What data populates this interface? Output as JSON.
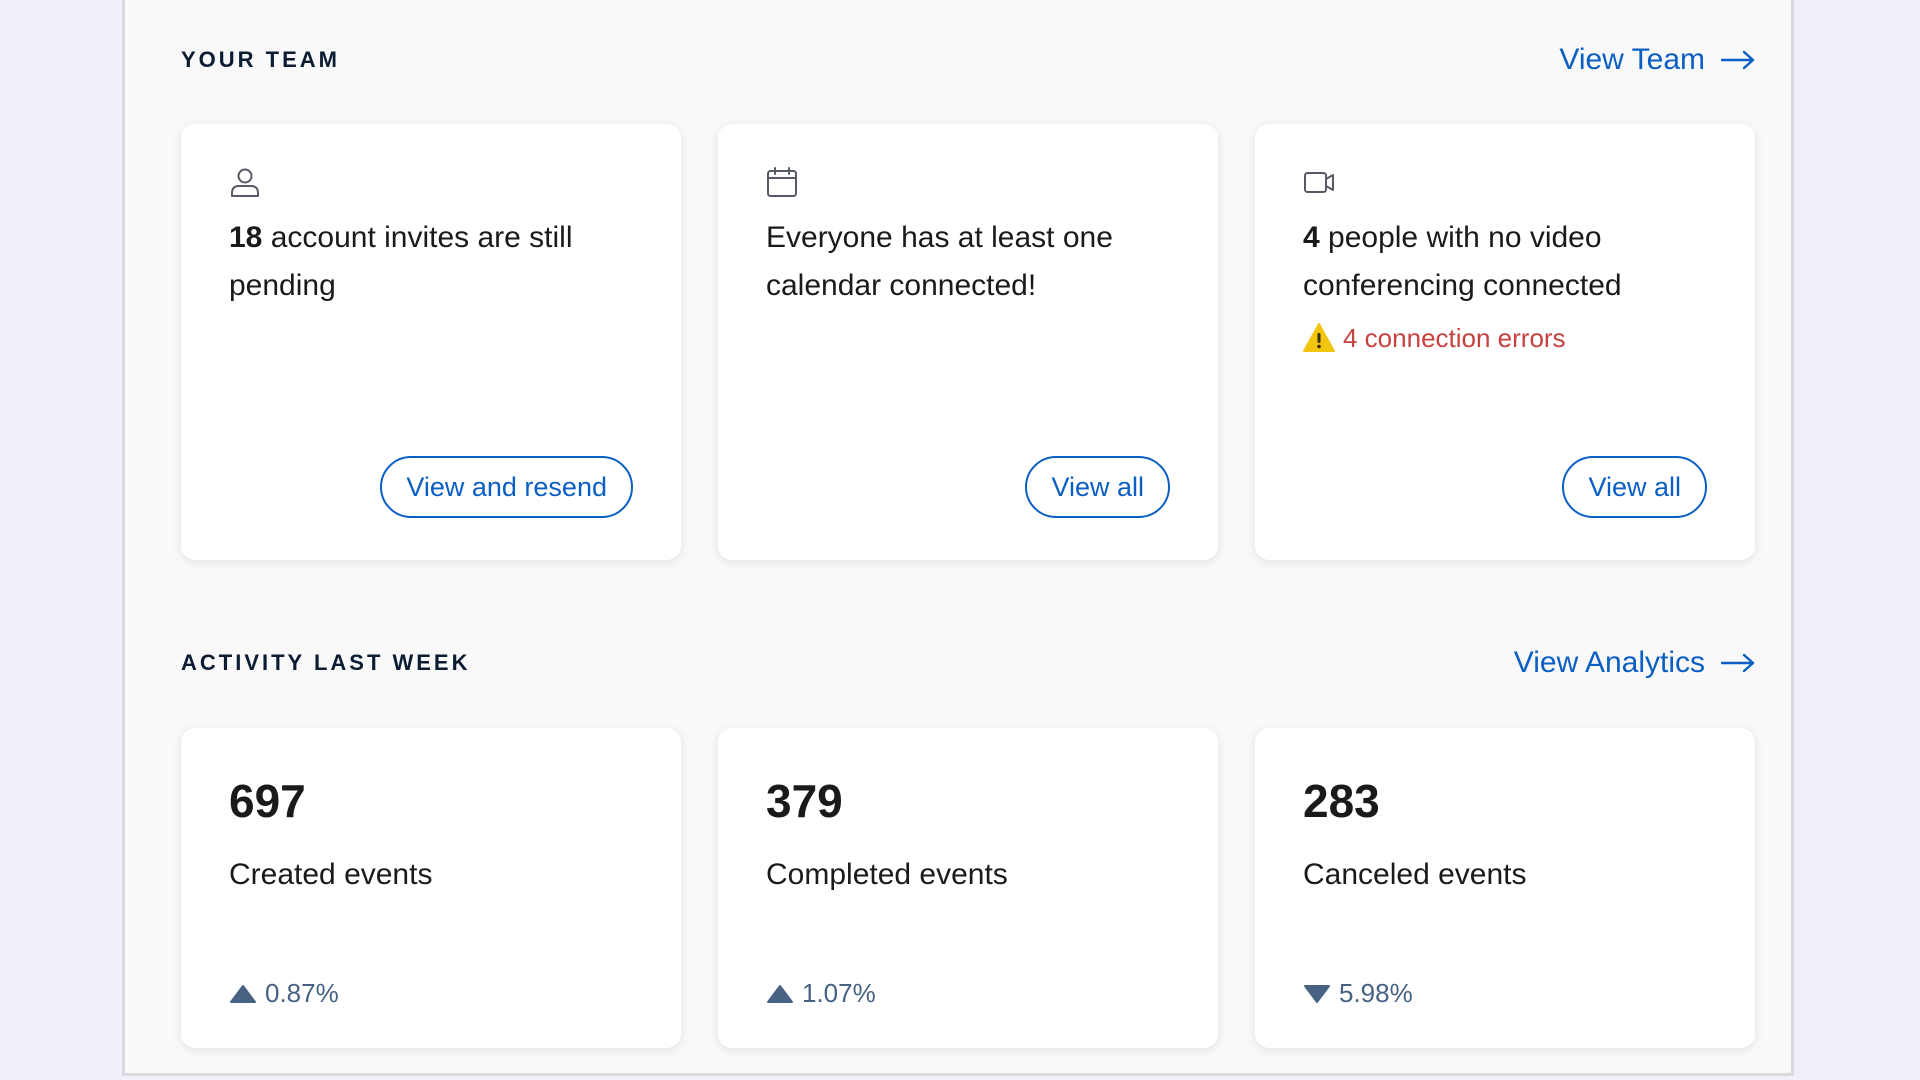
{
  "team": {
    "title": "YOUR TEAM",
    "link_label": "View Team",
    "cards": [
      {
        "icon": "user-icon",
        "bold": "18",
        "text": " account invites are still pending",
        "button": "View and resend"
      },
      {
        "icon": "calendar-icon",
        "bold": "",
        "text": "Everyone has at least one calendar connected!",
        "button": "View all"
      },
      {
        "icon": "video-camera-icon",
        "bold": "4",
        "text": " people with no video conferencing connected",
        "warning": "4 connection errors",
        "button": "View all"
      }
    ]
  },
  "activity": {
    "title": "ACTIVITY LAST WEEK",
    "link_label": "View Analytics",
    "stats": [
      {
        "value": "697",
        "label": "Created events",
        "change": "0.87%",
        "direction": "up"
      },
      {
        "value": "379",
        "label": "Completed events",
        "change": "1.07%",
        "direction": "up"
      },
      {
        "value": "283",
        "label": "Canceled events",
        "change": "5.98%",
        "direction": "down"
      }
    ]
  },
  "colors": {
    "accent": "#0b5fc4",
    "heading": "#0b1c33",
    "error": "#c8413f",
    "warning": "#f2c511",
    "trend": "#476282",
    "page_bg": "#eff0fa",
    "panel_bg": "#f9f9f9"
  }
}
